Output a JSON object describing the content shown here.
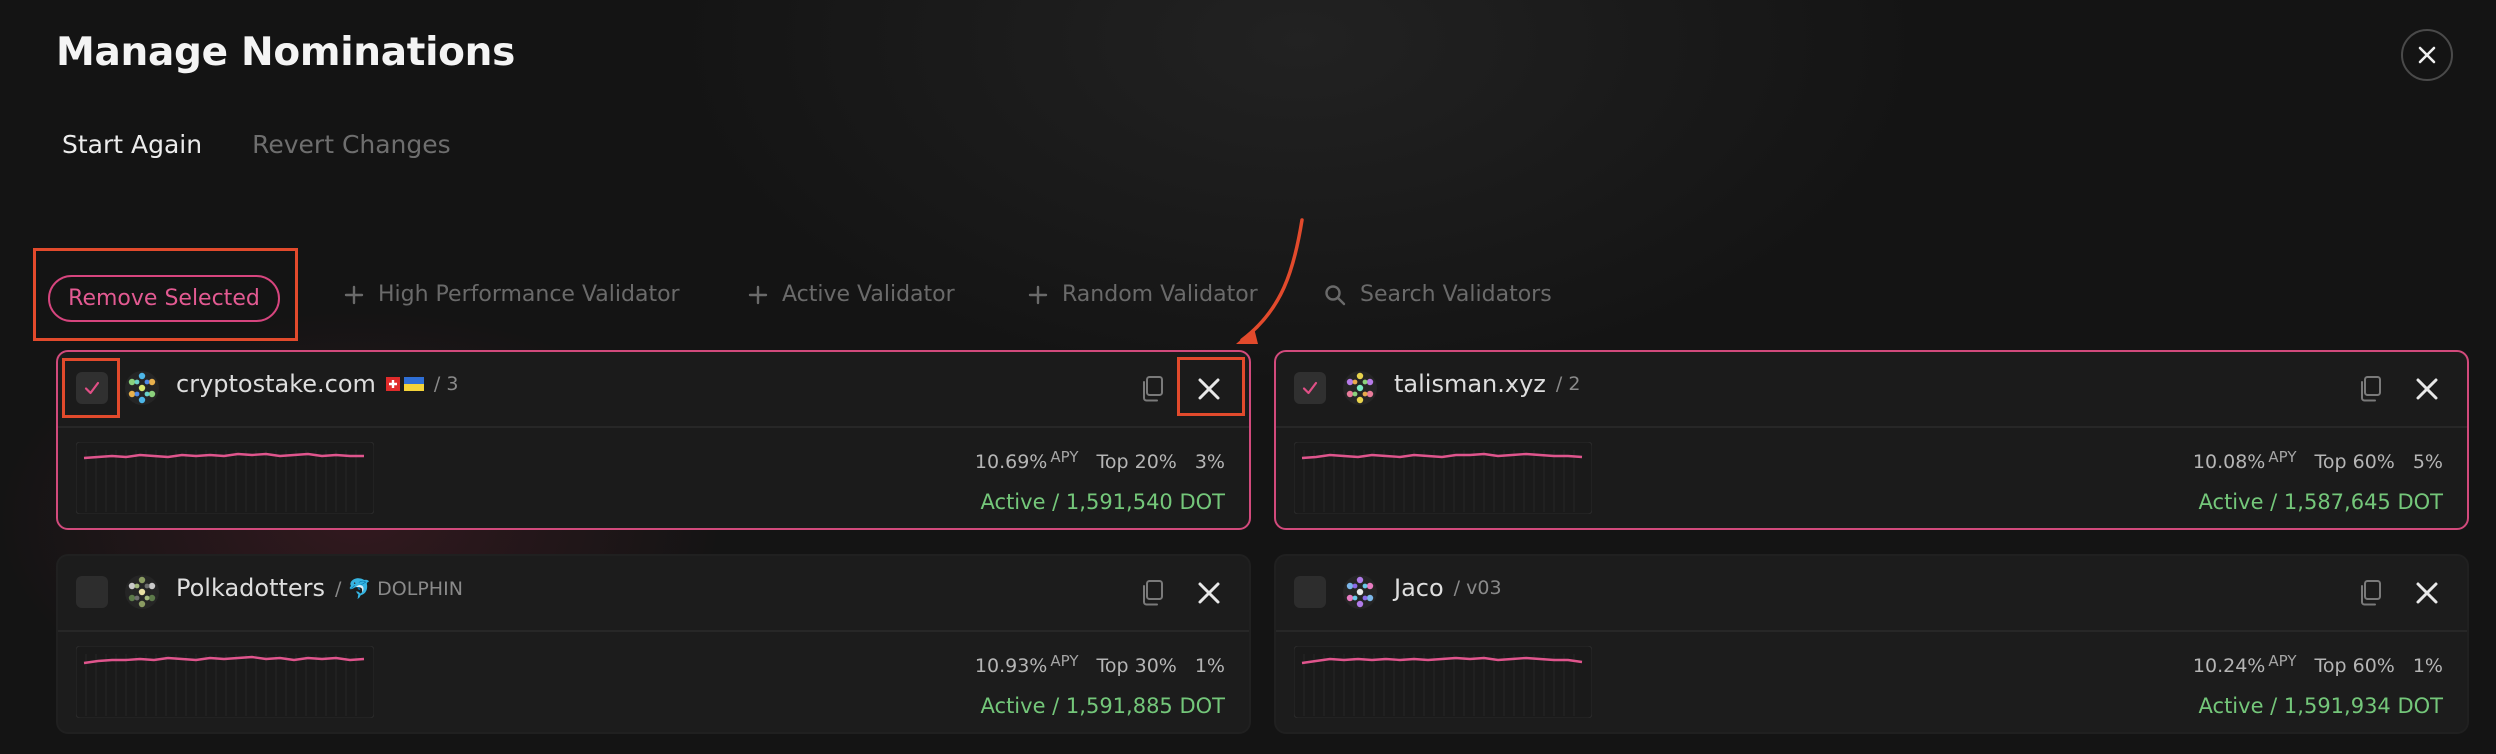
{
  "page": {
    "title": "Manage Nominations",
    "close_icon": "close-icon"
  },
  "tabs": [
    {
      "label": "Start Again",
      "active": true
    },
    {
      "label": "Revert Changes",
      "active": false
    }
  ],
  "toolbar": {
    "remove_selected": "Remove Selected",
    "high_performance": "High Performance Validator",
    "active_validator": "Active Validator",
    "random_validator": "Random Validator",
    "search_validators": "Search Validators"
  },
  "colors": {
    "accent_pink": "#d24a7c",
    "active_green": "#74c77a",
    "annotation_red": "#e24a2c"
  },
  "validators": [
    {
      "name": "cryptostake.com",
      "flags": [
        "swiss-flag",
        "ukraine-flag"
      ],
      "sub": "/ 3",
      "selected": true,
      "apy": "10.69%",
      "apy_label": "APY",
      "rank": "Top 20%",
      "commission": "3%",
      "status": "Active / 1,591,540 DOT"
    },
    {
      "name": "talisman.xyz",
      "flags": [],
      "sub": "/ 2",
      "selected": true,
      "apy": "10.08%",
      "apy_label": "APY",
      "rank": "Top 60%",
      "commission": "5%",
      "status": "Active / 1,587,645 DOT"
    },
    {
      "name": "Polkadotters",
      "flags": [],
      "sub": "/ 🐬 DOLPHIN",
      "selected": false,
      "apy": "10.93%",
      "apy_label": "APY",
      "rank": "Top 30%",
      "commission": "1%",
      "status": "Active / 1,591,885 DOT"
    },
    {
      "name": "Jaco",
      "flags": [],
      "sub": "/ v03",
      "selected": false,
      "apy": "10.24%",
      "apy_label": "APY",
      "rank": "Top 60%",
      "commission": "1%",
      "status": "Active / 1,591,934 DOT"
    }
  ]
}
